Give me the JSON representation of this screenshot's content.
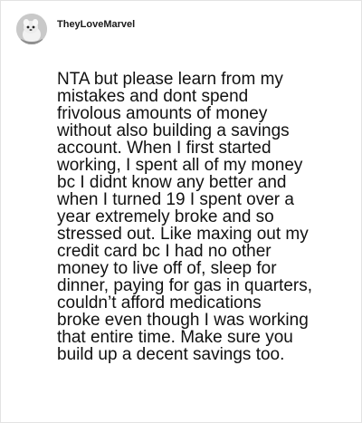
{
  "post": {
    "username": "TheyLoveMarvel",
    "avatar_icon": "user-avatar-icon",
    "comment": "NTA but please learn from my\nmistakes and dont spend\nfrivolous amounts of money\nwithout also building a savings\naccount. When I first started\nworking, I spent all of my money\nbc I didnt know any better and\nwhen I turned 19 I spent over a\nyear extremely broke and so\nstressed out. Like maxing out my\ncredit card bc I had no other\nmoney to live off of, sleep for\ndinner, paying for gas in quarters,\ncouldn’t afford medications\nbroke even though I was working\nthat entire time. Make sure you\nbuild up a decent savings too."
  }
}
